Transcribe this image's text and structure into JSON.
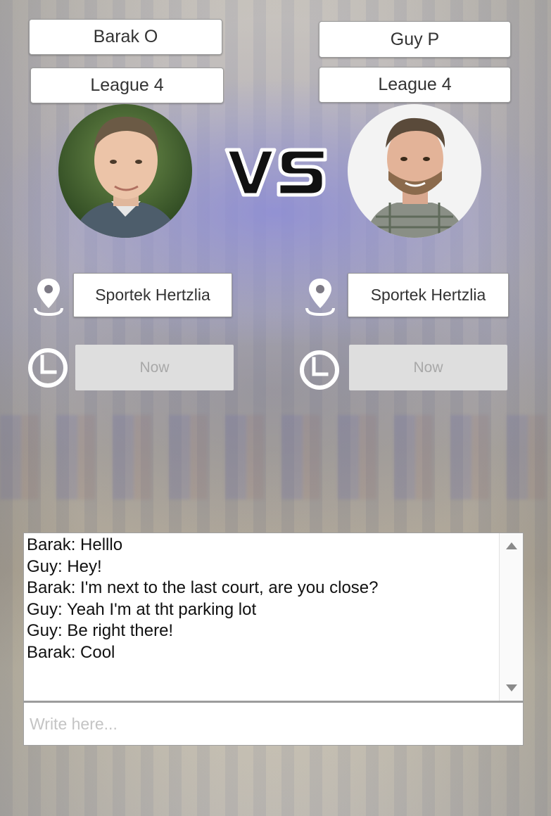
{
  "players": {
    "left": {
      "name": "Barak O",
      "league": "League 4",
      "location": "Sportek Hertzlia",
      "time": "Now"
    },
    "right": {
      "name": "Guy P",
      "league": "League 4",
      "location": "Sportek Hertzlia",
      "time": "Now"
    }
  },
  "versus_label": "VS",
  "icons": {
    "location": "location-pin-icon",
    "time": "clock-icon"
  },
  "chat": {
    "messages": [
      "Barak: Helllo",
      "Guy: Hey!",
      "Barak: I'm next to the last court, are you close?",
      "Guy: Yeah I'm at tht parking lot",
      "Guy: Be right there!",
      "Barak: Cool"
    ],
    "input_placeholder": "Write here..."
  },
  "colors": {
    "background_tint": "#a9a8b4",
    "button_disabled": "#dedede"
  }
}
